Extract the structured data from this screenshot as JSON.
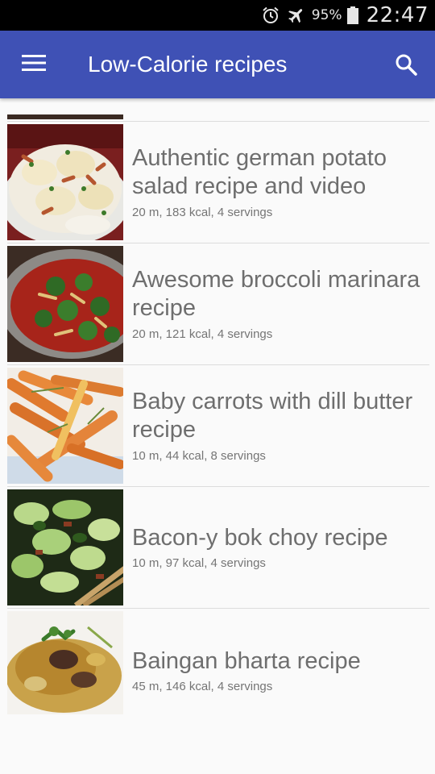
{
  "status_bar": {
    "battery_percent": "95%",
    "time": "22:47",
    "icons": [
      "alarm-icon",
      "airplane-mode-icon",
      "battery-icon"
    ]
  },
  "app_bar": {
    "title": "Low-Calorie recipes",
    "menu_icon": "hamburger-menu-icon",
    "search_icon": "search-icon"
  },
  "recipes": [
    {
      "title": "Authentic german potato salad recipe and video",
      "meta": "20 m, 183 kcal, 4 servings",
      "image": "potato-salad-photo"
    },
    {
      "title": "Awesome broccoli marinara recipe",
      "meta": "20 m, 121 kcal, 4 servings",
      "image": "broccoli-marinara-photo"
    },
    {
      "title": "Baby carrots with dill butter recipe",
      "meta": "10 m, 44 kcal, 8 servings",
      "image": "baby-carrots-photo"
    },
    {
      "title": "Bacon-y bok choy recipe",
      "meta": "10 m, 97 kcal, 4 servings",
      "image": "bok-choy-photo"
    },
    {
      "title": "Baingan bharta  recipe",
      "meta": "45 m, 146 kcal, 4 servings",
      "image": "baingan-bharta-photo"
    }
  ],
  "colors": {
    "app_bar": "#3f51b5",
    "status_bar": "#000000",
    "background": "#fafafa",
    "title_text": "#6e6e6e",
    "meta_text": "#757575"
  }
}
